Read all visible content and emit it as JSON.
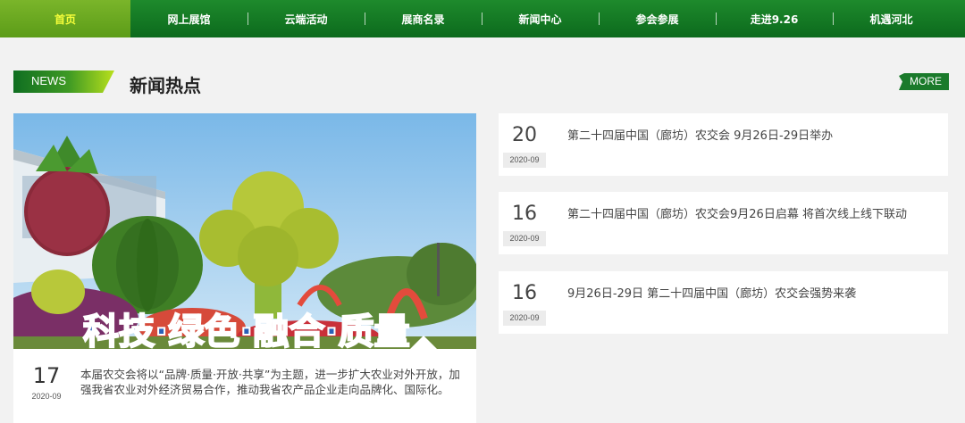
{
  "nav": {
    "items": [
      {
        "label": "首页",
        "active": true
      },
      {
        "label": "网上展馆"
      },
      {
        "label": "云端活动"
      },
      {
        "label": "展商名录"
      },
      {
        "label": "新闻中心"
      },
      {
        "label": "参会参展"
      },
      {
        "label": "走进9.26"
      },
      {
        "label": "机遇河北"
      }
    ]
  },
  "section": {
    "tag": "NEWS",
    "title": "新闻热点",
    "more_label": "MORE"
  },
  "featured": {
    "image_text": "科技·绿色·融合·质量",
    "day": "17",
    "year_month": "2020-09",
    "summary": "本届农交会将以“品牌·质量·开放·共享”为主题，进一步扩大农业对外开放，加强我省农业对外经济贸易合作，推动我省农产品企业走向品牌化、国际化。"
  },
  "news": [
    {
      "day": "20",
      "year_month": "2020-09",
      "title": "第二十四届中国（廊坊）农交会 9月26日-29日举办"
    },
    {
      "day": "16",
      "year_month": "2020-09",
      "title": "第二十四届中国（廊坊）农交会9月26日启幕 将首次线上线下联动"
    },
    {
      "day": "16",
      "year_month": "2020-09",
      "title": "9月26日-29日 第二十四届中国（廊坊）农交会强势来袭"
    }
  ],
  "colors": {
    "nav_green": "#0c6a1d",
    "nav_active": "#6aa820",
    "accent_yellow": "#f7ff3a",
    "more_green": "#1a7a2b"
  }
}
